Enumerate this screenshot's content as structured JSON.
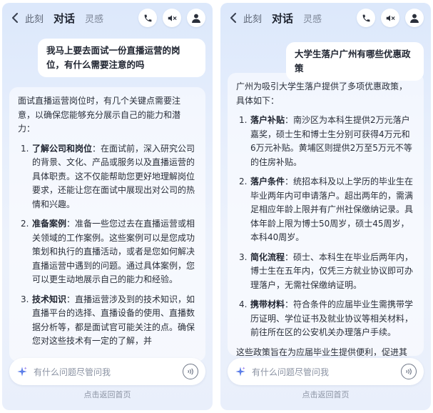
{
  "left": {
    "tabs": [
      "此刻",
      "对话",
      "灵感"
    ],
    "user_message": "我马上要去面试一份直播运营的岗位，有什么需要注意的吗",
    "intro": "面试直播运营岗位时，有几个关键点需要注意，以确保您能够充分展示自己的能力和潜力：",
    "items": [
      {
        "num": "1.",
        "title": "了解公司和岗位",
        "text": "：在面试前，深入研究公司的背景、文化、产品或服务以及直播运营的具体职责。这不仅能帮助您更好地理解岗位要求，还能让您在面试中展现出对公司的热情和兴趣。"
      },
      {
        "num": "2.",
        "title": "准备案例",
        "text": "：准备一些您过去在直播运营或相关领域的工作案例。这些案例可以是您成功策划和执行的直播活动，或者是您如何解决直播运营中遇到的问题。通过具体案例，您可以更生动地展示自己的能力和经验。"
      },
      {
        "num": "3.",
        "title": "技术知识",
        "text": "：直播运营涉及到的技术知识，如直播平台的选择、直播设备的使用、直播数据分析等，都是面试官可能关注的点。确保您对这些技术有一定的了解，并"
      }
    ],
    "input_placeholder": "有什么问题尽管问我",
    "footer": "点击返回首页"
  },
  "right": {
    "tabs": [
      "此刻",
      "对话",
      "灵感"
    ],
    "user_message": "大学生落户广州有哪些优惠政策",
    "intro": "广州为吸引大学生落户提供了多项优惠政策，具体如下：",
    "items": [
      {
        "num": "1.",
        "title": "落户补贴",
        "text": "：南沙区为本科生提供2万元落户嘉奖，硕士生和博士生分别可获得4万元和6万元补贴。黄埔区则提供2万至5万元不等的住房补贴。"
      },
      {
        "num": "2.",
        "title": "落户条件",
        "text": "：统招本科及以上学历的毕业生在毕业两年内可申请落户。超出两年的，需满足相应年龄上限并有广州社保缴纳记录。具体年龄上限为博士50周岁，硕士45周岁，本科40周岁。"
      },
      {
        "num": "3.",
        "title": "简化流程",
        "text": "：硕士、本科生在毕业后两年内，博士生在五年内，仅凭三方就业协议即可办理落户，无需社保缴纳证明。"
      },
      {
        "num": "4.",
        "title": "携带材料",
        "text": "：符合条件的应届毕业生需携带学历证明、学位证书及就业协议等相关材料，前往所在区的公安机关办理落户手续。"
      }
    ],
    "outro": "这些政策旨在为应届毕业生提供便利，促进其在广州的就业和发展。",
    "input_placeholder": "有什么问题尽管问我",
    "footer": "点击返回首页"
  }
}
